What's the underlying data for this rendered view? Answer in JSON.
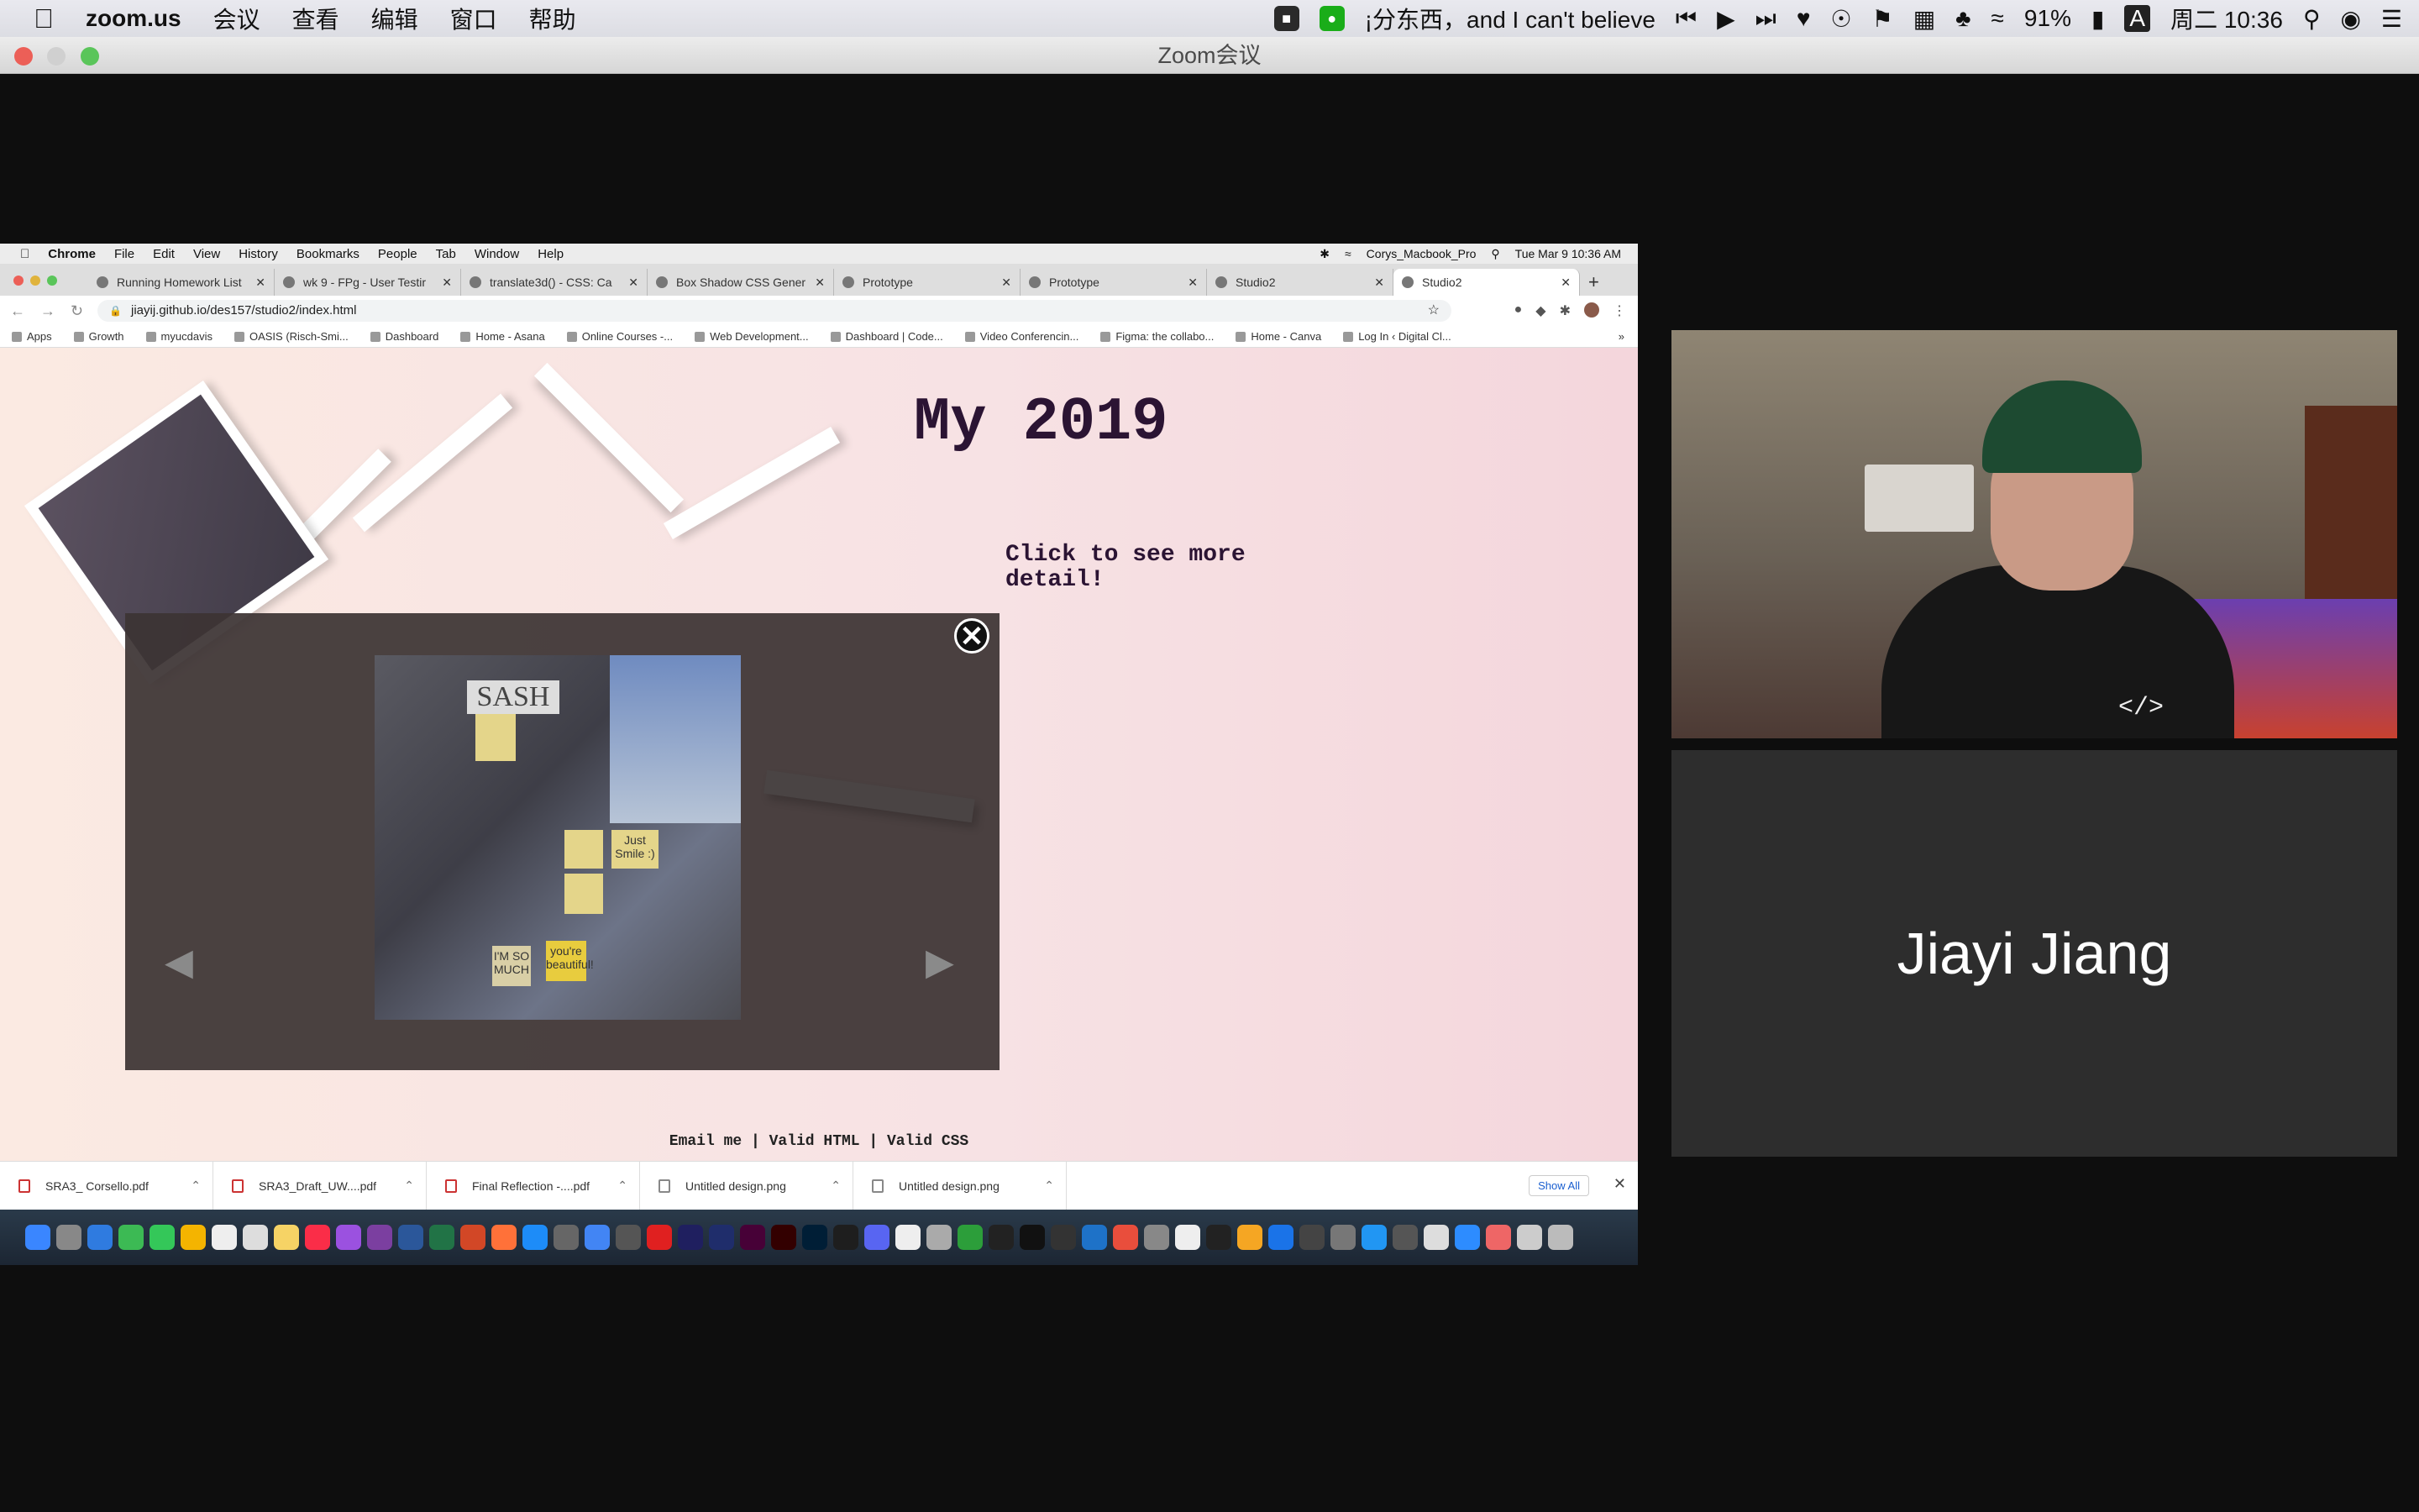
{
  "mac_menubar": {
    "app_name": "zoom.us",
    "menus": [
      "会议",
      "查看",
      "编辑",
      "窗口",
      "帮助"
    ],
    "now_playing": "¡分东西，and I can't believe",
    "battery": "91%",
    "clock": "周二 10:36",
    "input_method": "A"
  },
  "zoom_window": {
    "title": "Zoom会议"
  },
  "chrome_menubar": {
    "items": [
      "Chrome",
      "File",
      "Edit",
      "View",
      "History",
      "Bookmarks",
      "People",
      "Tab",
      "Window",
      "Help"
    ],
    "computer_name": "Corys_Macbook_Pro",
    "clock": "Tue Mar 9  10:36 AM"
  },
  "tabs": [
    {
      "label": "Running Homework List"
    },
    {
      "label": "wk 9 - FPg - User Testir"
    },
    {
      "label": "translate3d() - CSS: Ca"
    },
    {
      "label": "Box Shadow CSS Gener"
    },
    {
      "label": "Prototype"
    },
    {
      "label": "Prototype"
    },
    {
      "label": "Studio2"
    },
    {
      "label": "Studio2"
    }
  ],
  "address_bar": {
    "url": "jiayij.github.io/des157/studio2/index.html"
  },
  "bookmarks": [
    "Apps",
    "Growth",
    "myucdavis",
    "OASIS (Risch-Smi...",
    "Dashboard",
    "Home - Asana",
    "Online Courses -...",
    "Web Development...",
    "Dashboard | Code...",
    "Video Conferencin...",
    "Figma: the collabo...",
    "Home - Canva",
    "Log In ‹ Digital Cl..."
  ],
  "page": {
    "title": "My 2019",
    "subtitle": "Click to see more detail!",
    "close_symbol": "✕",
    "prev_arrow": "◀",
    "next_arrow": "▶",
    "photo_sign": "SASH",
    "photo_notes": [
      "Just Smile :)",
      "you're beautiful!",
      "I'M SO MUCH"
    ],
    "footer": "Email me | Valid HTML | Valid CSS"
  },
  "downloads": {
    "files": [
      "SRA3_ Corsello.pdf",
      "SRA3_Draft_UW....pdf",
      "Final Reflection -....pdf",
      "Untitled design.png",
      "Untitled design.png"
    ],
    "show_all": "Show All"
  },
  "video": {
    "participant_name": "Jiayi Jiang",
    "overlay_tag": "</>"
  }
}
